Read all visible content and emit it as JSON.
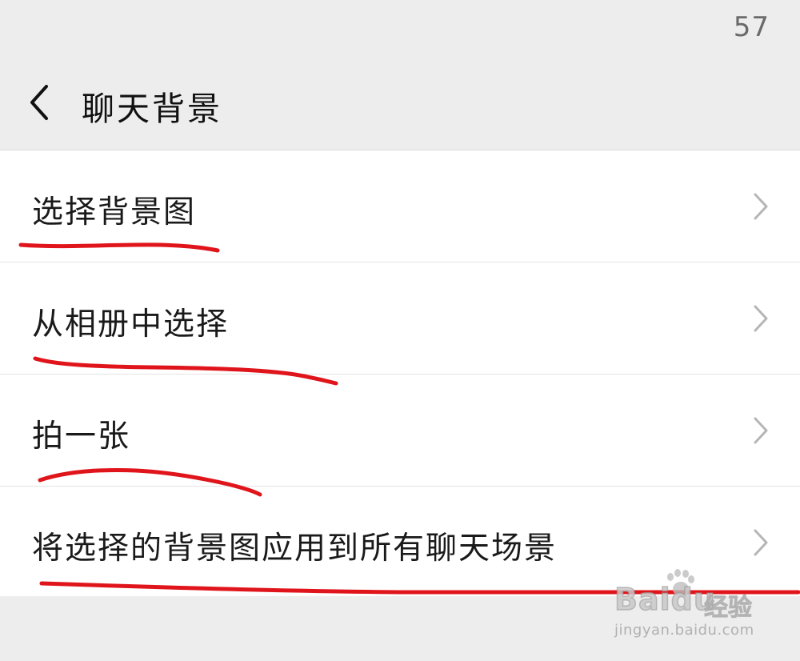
{
  "status_bar": {
    "time_partial": "57"
  },
  "nav": {
    "title": "聊天背景",
    "back_icon": "chevron-left-icon"
  },
  "menu": {
    "items": [
      {
        "label": "选择背景图",
        "icon": "chevron-right-icon"
      },
      {
        "label": "从相册中选择",
        "icon": "chevron-right-icon"
      },
      {
        "label": "拍一张",
        "icon": "chevron-right-icon"
      },
      {
        "label": "将选择的背景图应用到所有聊天场景",
        "icon": "chevron-right-icon"
      }
    ]
  },
  "annotation": {
    "underline_color": "#e0151c"
  },
  "watermark": {
    "brand": "Baidu",
    "cn": "经验",
    "url": "jingyan.baidu.com"
  },
  "colors": {
    "background": "#ededed",
    "list_background": "#ffffff",
    "chevron": "#b5b5b5",
    "text": "#1a1a1a"
  }
}
